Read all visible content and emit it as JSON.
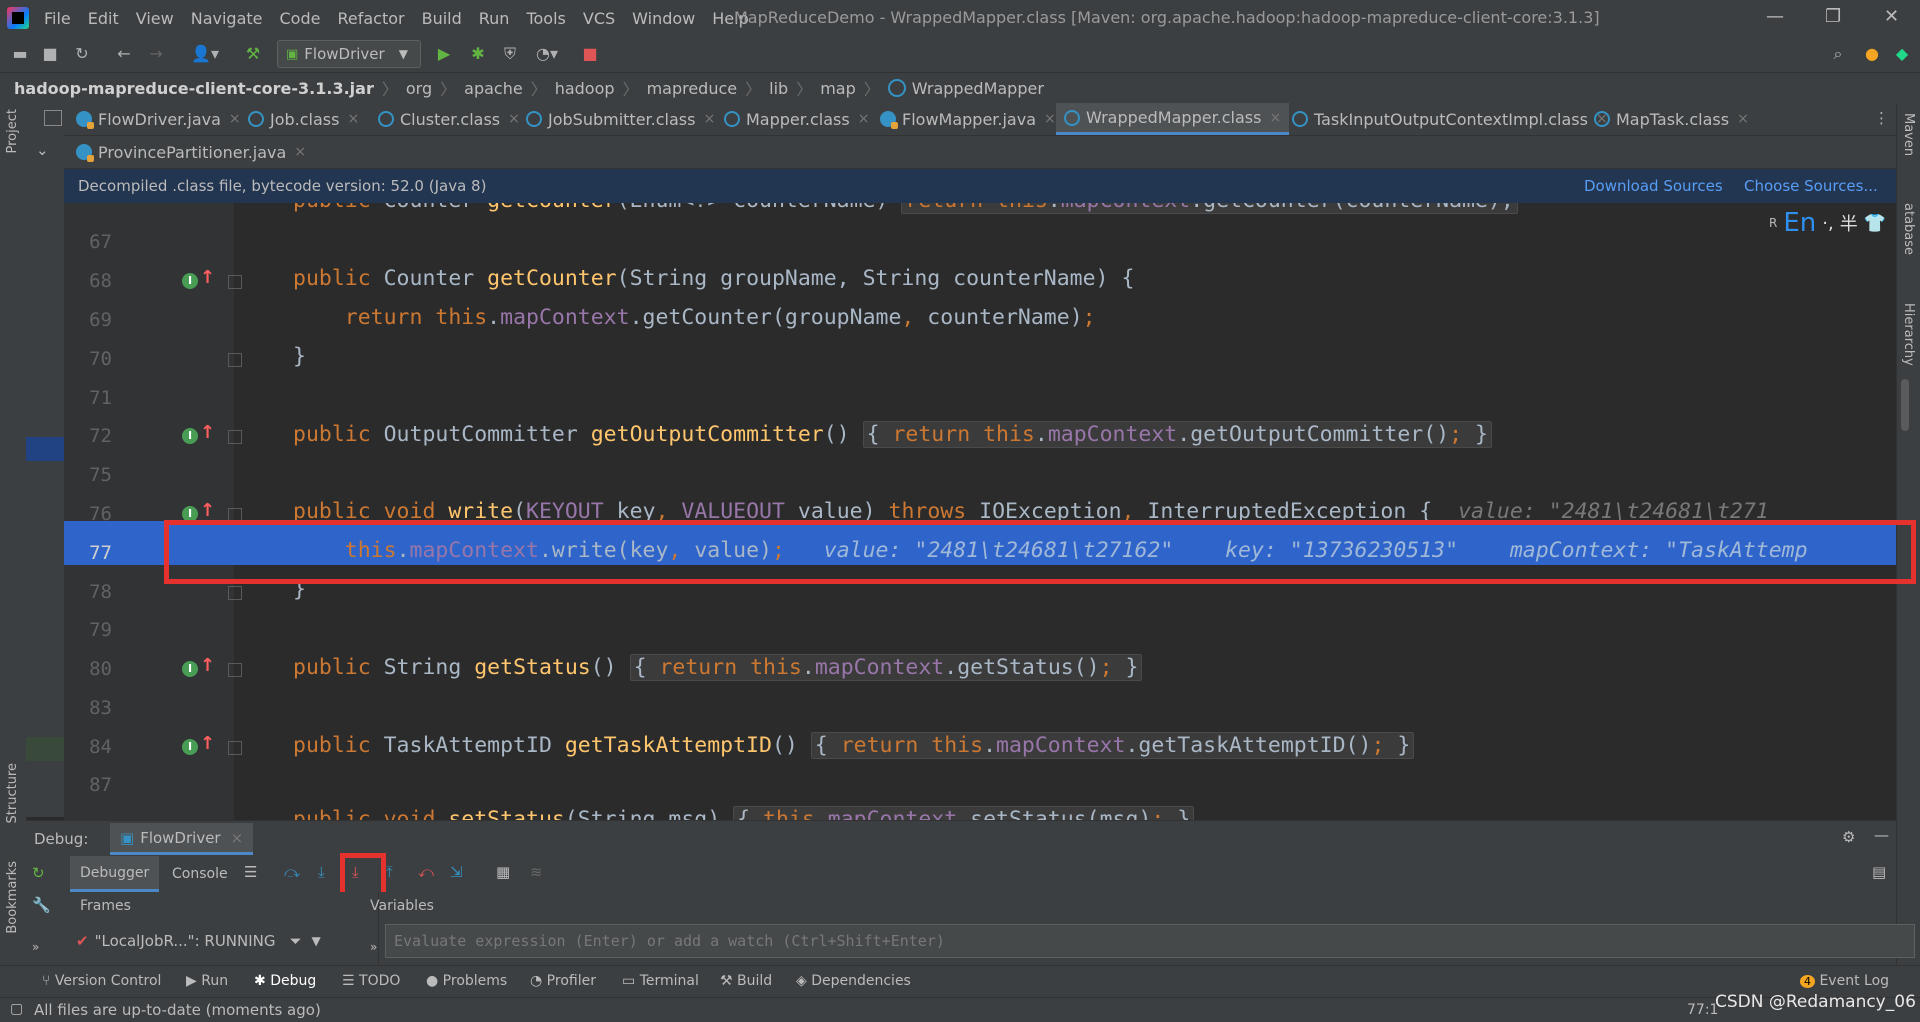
{
  "menubar": {
    "items": [
      "File",
      "Edit",
      "View",
      "Navigate",
      "Code",
      "Refactor",
      "Build",
      "Run",
      "Tools",
      "VCS",
      "Window",
      "Help"
    ],
    "title": "MapReduceDemo - WrappedMapper.class [Maven: org.apache.hadoop:hadoop-mapreduce-client-core:3.1.3]"
  },
  "toolbar": {
    "run_config": "FlowDriver"
  },
  "breadcrumb": [
    "hadoop-mapreduce-client-core-3.1.3.jar",
    "org",
    "apache",
    "hadoop",
    "mapreduce",
    "lib",
    "map",
    "WrappedMapper"
  ],
  "tabs_row1": [
    {
      "label": "FlowDriver.java",
      "kind": "java"
    },
    {
      "label": "Job.class",
      "kind": "class"
    },
    {
      "label": "Cluster.class",
      "kind": "class"
    },
    {
      "label": "JobSubmitter.class",
      "kind": "class"
    },
    {
      "label": "Mapper.class",
      "kind": "class"
    },
    {
      "label": "FlowMapper.java",
      "kind": "java"
    },
    {
      "label": "WrappedMapper.class",
      "kind": "class",
      "active": true
    },
    {
      "label": "TaskInputOutputContextImpl.class",
      "kind": "class"
    },
    {
      "label": "MapTask.class",
      "kind": "class"
    }
  ],
  "tabs_row2": [
    {
      "label": "ProvincePartitioner.java",
      "kind": "java"
    }
  ],
  "banner": {
    "text": "Decompiled .class file, bytecode version: 52.0 (Java 8)",
    "download": "Download Sources",
    "choose": "Choose Sources..."
  },
  "ime": "En",
  "editor": {
    "line_numbers": [
      "67",
      "68",
      "69",
      "70",
      "71",
      "72",
      "75",
      "76",
      "77",
      "78",
      "79",
      "80",
      "83",
      "84",
      "87"
    ],
    "line77": {
      "hint_value": "value: \"2481\\t24681\\t27162\"",
      "hint_key": "key: \"13736230513\"",
      "hint_ctx": "mapContext: \"TaskAttemp"
    },
    "line76_hint": "value: \"2481\\t24681\\t271"
  },
  "debug": {
    "label": "Debug:",
    "session": "FlowDriver",
    "tabs": [
      "Debugger",
      "Console"
    ],
    "frames_label": "Frames",
    "variables_label": "Variables",
    "thread": "\"LocalJobR...\": RUNNING",
    "eval_placeholder": "Evaluate expression (Enter) or add a watch (Ctrl+Shift+Enter)"
  },
  "left_strip": [
    "Project",
    "Structure",
    "Bookmarks"
  ],
  "right_strip": [
    "Maven",
    "atabase",
    "Hierarchy"
  ],
  "bottom_tools": [
    "Version Control",
    "Run",
    "Debug",
    "TODO",
    "Problems",
    "Profiler",
    "Terminal",
    "Build",
    "Dependencies"
  ],
  "event_log": "Event Log",
  "event_count": "4",
  "status": {
    "message": "All files are up-to-date (moments ago)",
    "position": "77:1",
    "watermark": "CSDN @Redamancy_06"
  }
}
